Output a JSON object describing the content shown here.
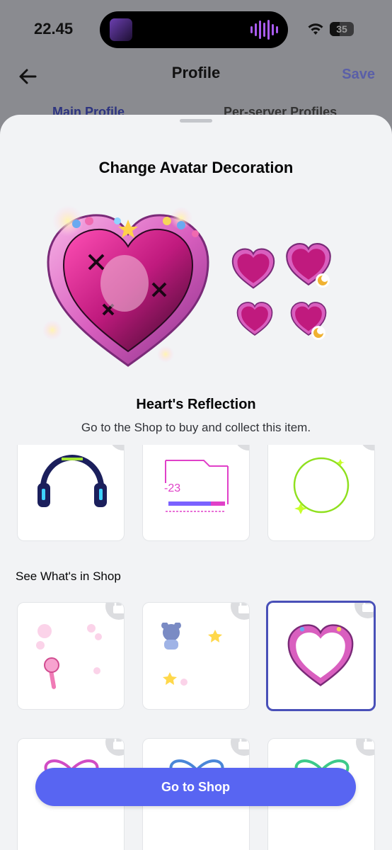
{
  "status_bar": {
    "time": "22.45",
    "battery": "35"
  },
  "nav": {
    "title": "Profile",
    "save_label": "Save",
    "tabs": [
      "Main Profile",
      "Per-server Profiles"
    ]
  },
  "sheet": {
    "title": "Change Avatar Decoration",
    "item_name": "Heart's Reflection",
    "item_description": "Go to the Shop to buy and collect this item.",
    "section_label": "See What's in Shop",
    "cta_label": "Go to Shop"
  },
  "colors": {
    "accent": "#5865f2",
    "selected_border": "#4950b8",
    "sheet_bg": "#f2f3f5",
    "heart_pink": "#e86fc4"
  },
  "decorations": {
    "owned": [
      {
        "icon": "headphones-decoration-icon"
      },
      {
        "icon": "cyber-hud-decoration-icon"
      },
      {
        "icon": "green-ring-decoration-icon"
      }
    ],
    "shop": [
      {
        "icon": "magic-wand-bubbles-decoration-icon",
        "locked": true,
        "selected": false
      },
      {
        "icon": "bear-stars-decoration-icon",
        "locked": true,
        "selected": false
      },
      {
        "icon": "heart-frame-decoration-icon",
        "locked": true,
        "selected": true
      },
      {
        "icon": "pink-ribbon-decoration-icon",
        "locked": true,
        "selected": false
      },
      {
        "icon": "blue-ribbon-decoration-icon",
        "locked": true,
        "selected": false
      },
      {
        "icon": "green-ribbon-decoration-icon",
        "locked": true,
        "selected": false
      }
    ]
  }
}
